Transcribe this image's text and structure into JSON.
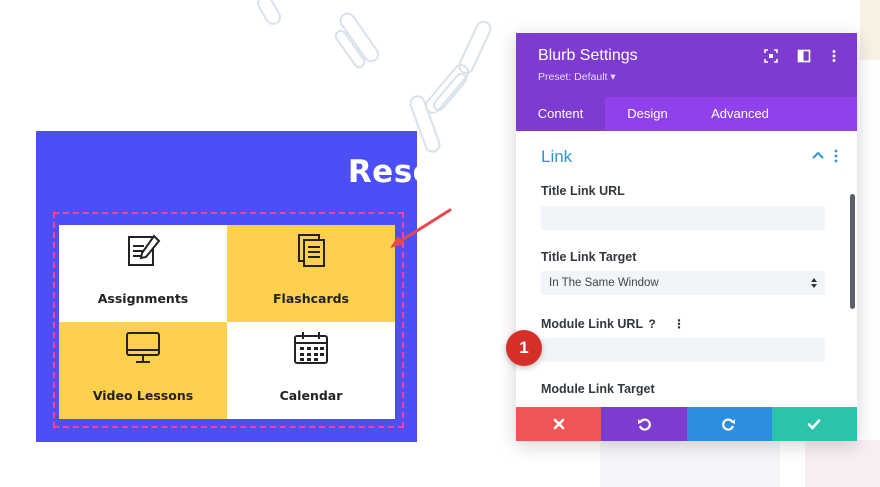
{
  "resources": {
    "title": "Resources",
    "items": [
      {
        "label": "Assignments",
        "icon": "assignment-icon",
        "bg": "#ffffff"
      },
      {
        "label": "Flashcards",
        "icon": "flashcards-icon",
        "bg": "#ffd04e"
      },
      {
        "label": "Video Lessons",
        "icon": "monitor-icon",
        "bg": "#ffd04e"
      },
      {
        "label": "Calendar",
        "icon": "calendar-icon",
        "bg": "#ffffff"
      }
    ],
    "background_color": "#4b4ff5",
    "outline_color": "#ff3f9e"
  },
  "panel": {
    "title": "Blurb Settings",
    "preset": "Preset: Default ▾",
    "header_icons": [
      "expand-icon",
      "split-view-icon",
      "more-options-icon"
    ],
    "tabs": [
      {
        "label": "Content",
        "active": true
      },
      {
        "label": "Design",
        "active": false
      },
      {
        "label": "Advanced",
        "active": false
      }
    ],
    "section_title": "Link",
    "fields": {
      "title_link_url": {
        "label": "Title Link URL",
        "value": ""
      },
      "title_link_target": {
        "label": "Title Link Target",
        "value": "In The Same Window"
      },
      "module_link_url": {
        "label": "Module Link URL",
        "value": "",
        "help": "?",
        "menu": "⋮"
      },
      "module_link_target": {
        "label": "Module Link Target"
      }
    },
    "footer": [
      {
        "name": "discard-button",
        "icon": "close-icon",
        "color": "#ef5555"
      },
      {
        "name": "undo-button",
        "icon": "undo-icon",
        "color": "#7d3bd0"
      },
      {
        "name": "redo-button",
        "icon": "redo-icon",
        "color": "#2b8ee0"
      },
      {
        "name": "save-button",
        "icon": "check-icon",
        "color": "#29c4a9"
      }
    ],
    "colors": {
      "header": "#7e3bd0",
      "tabs": "#8f42ec",
      "section": "#2d95d3"
    }
  },
  "step_badge": "1"
}
